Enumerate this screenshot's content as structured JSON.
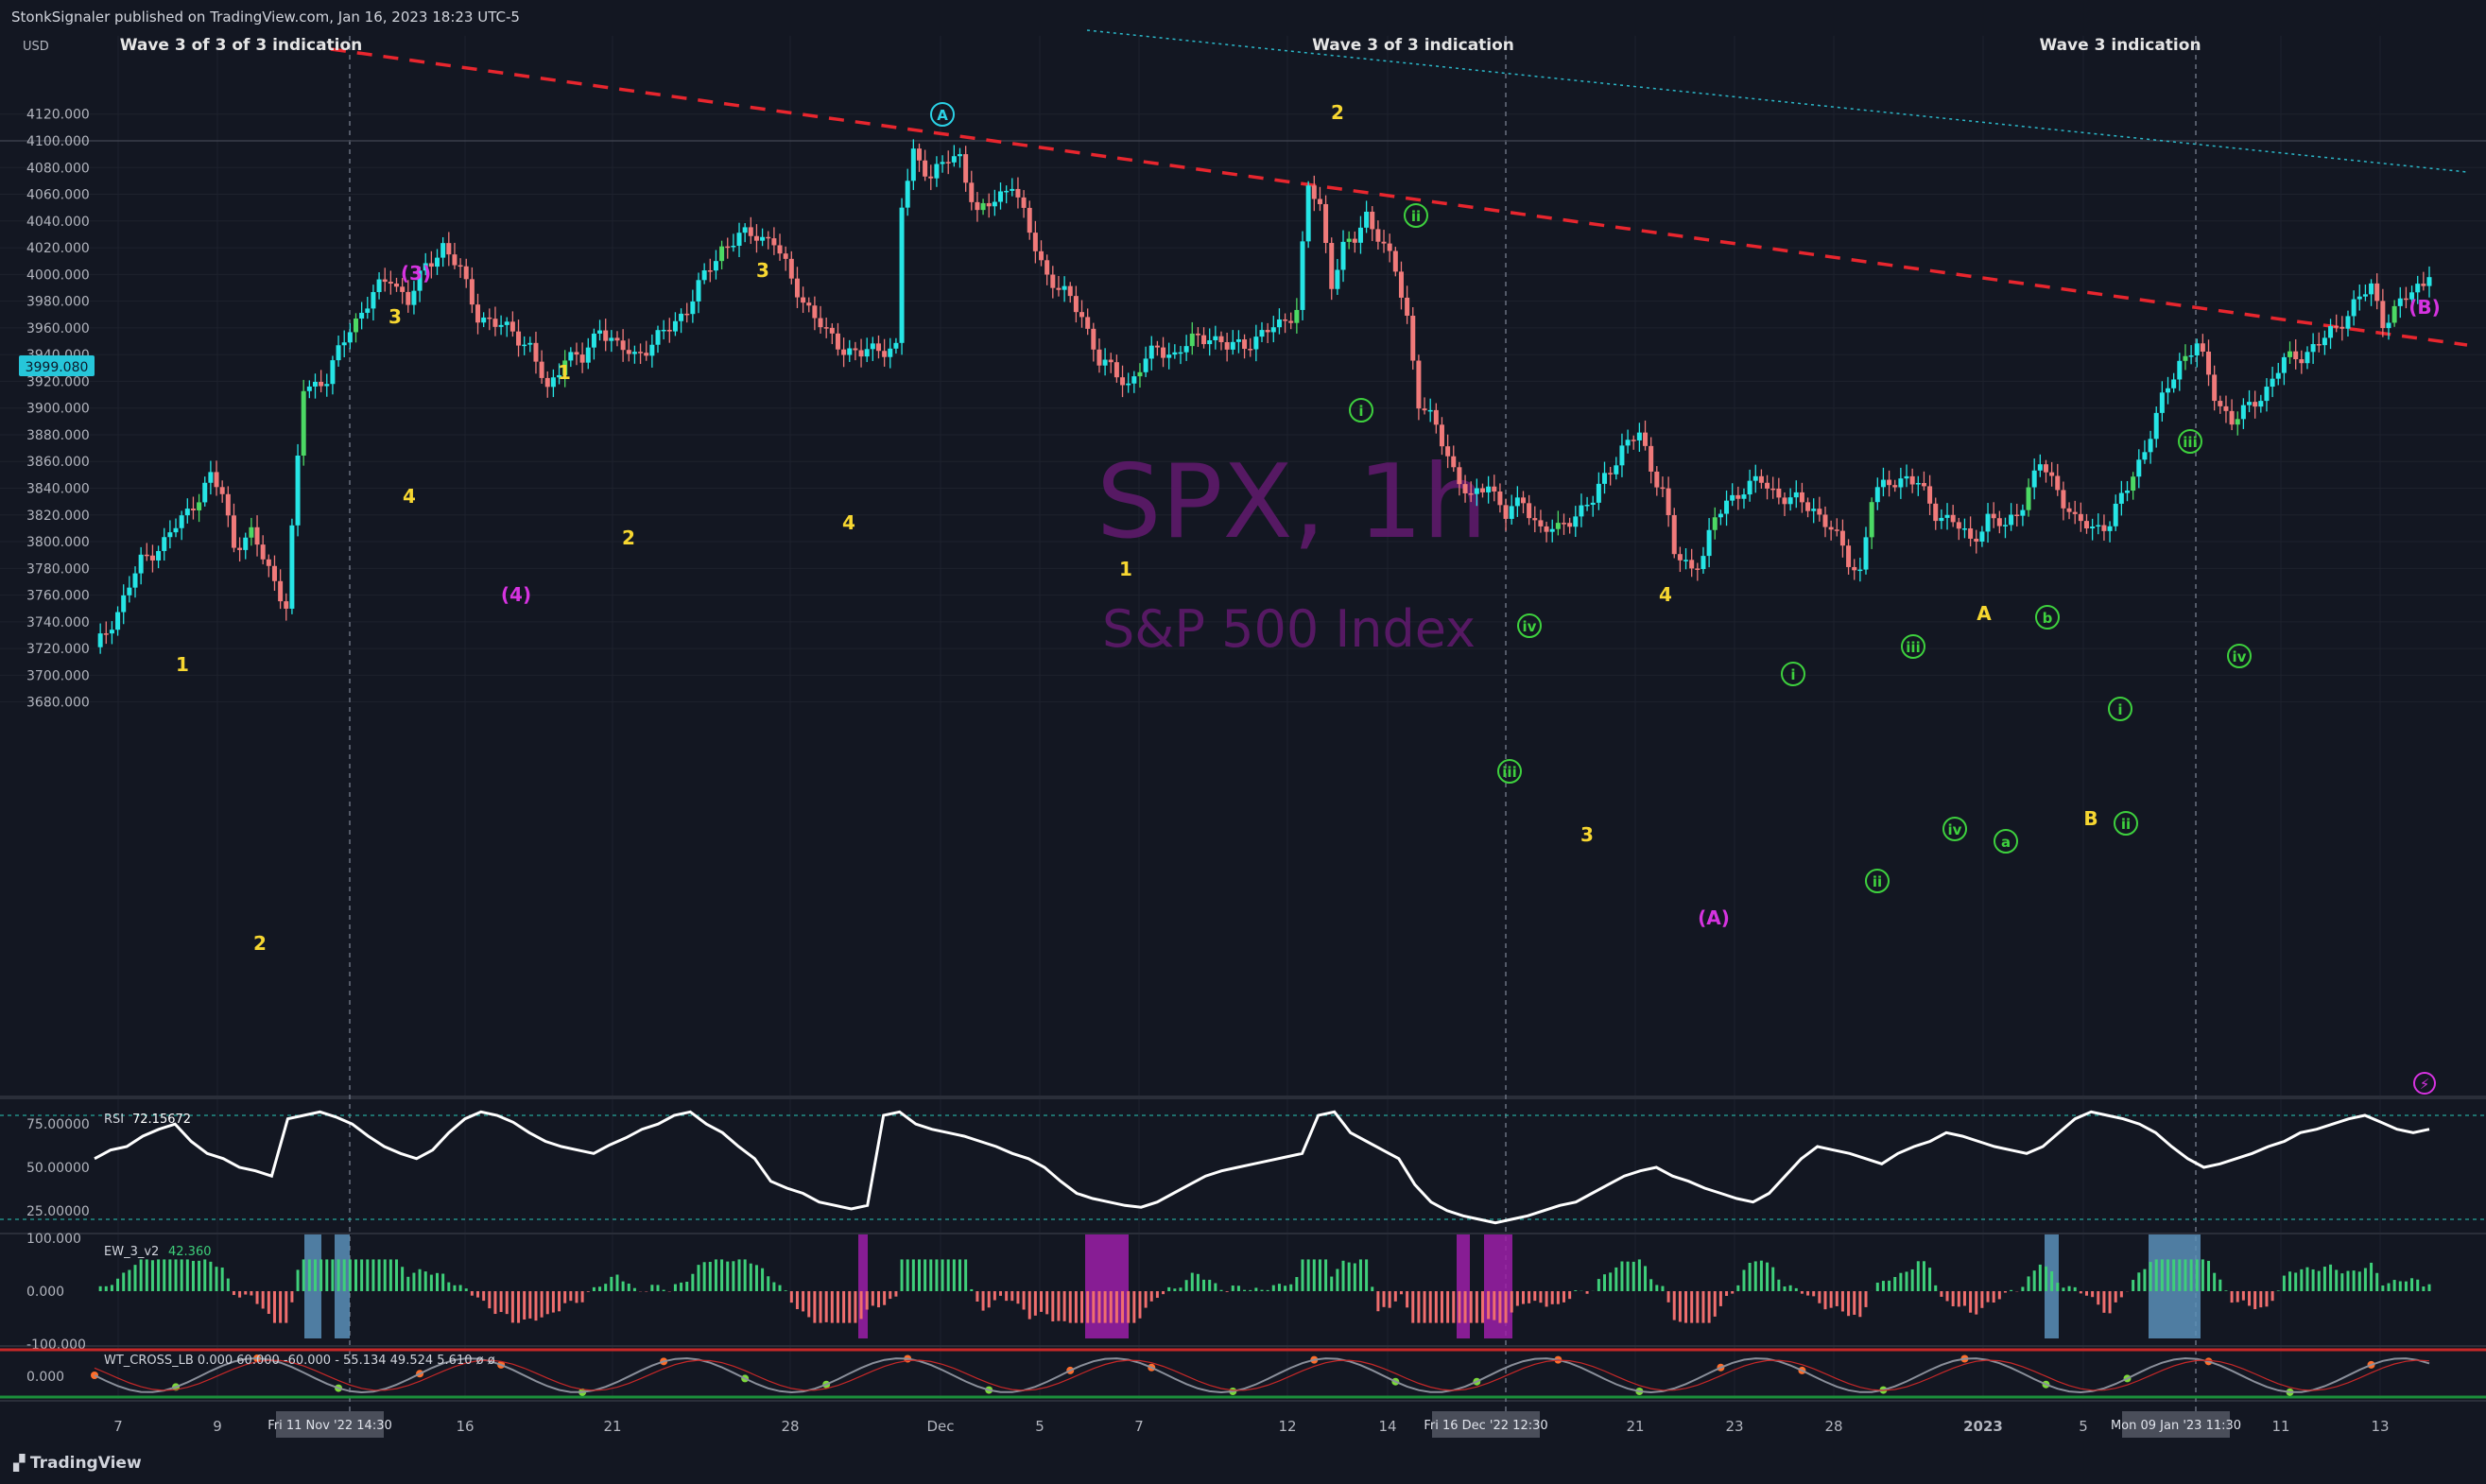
{
  "header": {
    "published": "StonkSignaler published on TradingView.com, Jan 16, 2023 18:23 UTC-5",
    "currency": "USD"
  },
  "watermark": {
    "symbol": "SPX, 1h",
    "name": "S&P 500 Index"
  },
  "footer": {
    "brand": "TradingView"
  },
  "colors": {
    "background": "#131722",
    "up": "#26e5e5",
    "down": "#f07a7a",
    "greenCandle": "#4cd964",
    "trendline": "#e8262e",
    "dotted": "#2bb7c8",
    "watermark": "#5e1a6b",
    "wave_yellow": "#f7d731",
    "wave_magenta": "#d633e0",
    "wave_green": "#3ed13e",
    "wave_cyan": "#2bd1e5"
  },
  "price_label": "3999.080",
  "annotations": [
    {
      "text": "Wave 3 of 3 of 3 indication"
    },
    {
      "text": "Wave 3 of 3 indication"
    },
    {
      "text": "Wave 3 indication"
    }
  ],
  "chart_data": [
    {
      "type": "candlestick",
      "title": "SPX, 1h",
      "subtitle": "S&P 500 Index",
      "ylabel": "USD",
      "ylim": [
        3665,
        4135
      ],
      "y_ticks": [
        3680,
        3700,
        3720,
        3740,
        3760,
        3780,
        3800,
        3820,
        3840,
        3860,
        3880,
        3900,
        3920,
        3940,
        3960,
        3980,
        4000,
        4020,
        4040,
        4060,
        4080,
        4100,
        4120
      ],
      "y_tick_labels": [
        "3680.000",
        "3700.000",
        "3720.000",
        "3740.000",
        "3760.000",
        "3780.000",
        "3800.000",
        "3820.000",
        "3840.000",
        "3860.000",
        "3880.000",
        "3900.000",
        "3920.000",
        "3940.000",
        "3960.000",
        "3980.000",
        "4000.000",
        "4020.000",
        "4040.000",
        "4060.000",
        "4080.000",
        "4100.000",
        "4120.000"
      ],
      "x_tick_labels": [
        "7",
        "9",
        "16",
        "21",
        "28",
        "Dec",
        "5",
        "7",
        "12",
        "14",
        "21",
        "23",
        "28",
        "2023",
        "5",
        "11",
        "13"
      ],
      "x_date_tags": [
        "Fri 11 Nov '22  14:30",
        "Fri 16 Dec '22  12:30",
        "Mon 09 Jan '23  11:30"
      ],
      "series": [
        {
          "name": "SPX",
          "close_path": [
            [
              0,
              3718
            ],
            [
              4,
              3748
            ],
            [
              8,
              3785
            ],
            [
              12,
              3800
            ],
            [
              16,
              3822
            ],
            [
              20,
              3848
            ],
            [
              22,
              3835
            ],
            [
              24,
              3798
            ],
            [
              27,
              3805
            ],
            [
              30,
              3780
            ],
            [
              33,
              3752
            ],
            [
              36,
              3915
            ],
            [
              40,
              3922
            ],
            [
              44,
              3960
            ],
            [
              48,
              3985
            ],
            [
              51,
              3998
            ],
            [
              54,
              3980
            ],
            [
              57,
              4005
            ],
            [
              60,
              4022
            ],
            [
              63,
              4002
            ],
            [
              66,
              3970
            ],
            [
              69,
              3962
            ],
            [
              72,
              3958
            ],
            [
              75,
              3945
            ],
            [
              78,
              3912
            ],
            [
              81,
              3940
            ],
            [
              84,
              3935
            ],
            [
              87,
              3962
            ],
            [
              90,
              3945
            ],
            [
              93,
              3940
            ],
            [
              96,
              3948
            ],
            [
              99,
              3960
            ],
            [
              102,
              3975
            ],
            [
              105,
              3998
            ],
            [
              108,
              4020
            ],
            [
              111,
              4028
            ],
            [
              114,
              4030
            ],
            [
              117,
              4025
            ],
            [
              120,
              3995
            ],
            [
              123,
              3975
            ],
            [
              126,
              3955
            ],
            [
              129,
              3945
            ],
            [
              132,
              3940
            ],
            [
              135,
              3945
            ],
            [
              138,
              3945
            ],
            [
              139,
              4050
            ],
            [
              141,
              4090
            ],
            [
              144,
              4075
            ],
            [
              147,
              4085
            ],
            [
              149,
              4088
            ],
            [
              152,
              4045
            ],
            [
              155,
              4055
            ],
            [
              158,
              4070
            ],
            [
              161,
              4030
            ],
            [
              164,
              4000
            ],
            [
              167,
              3985
            ],
            [
              170,
              3970
            ],
            [
              173,
              3935
            ],
            [
              176,
              3925
            ],
            [
              178,
              3918
            ],
            [
              180,
              3930
            ],
            [
              183,
              3945
            ],
            [
              186,
              3940
            ],
            [
              189,
              3950
            ],
            [
              192,
              3955
            ],
            [
              195,
              3945
            ],
            [
              198,
              3948
            ],
            [
              201,
              3955
            ],
            [
              204,
              3962
            ],
            [
              207,
              3975
            ],
            [
              209,
              4065
            ],
            [
              211,
              4050
            ],
            [
              213,
              3995
            ],
            [
              215,
              4020
            ],
            [
              217,
              4025
            ],
            [
              219,
              4045
            ],
            [
              221,
              4030
            ],
            [
              224,
              4002
            ],
            [
              226,
              3968
            ],
            [
              228,
              3905
            ],
            [
              231,
              3885
            ],
            [
              234,
              3855
            ],
            [
              237,
              3830
            ],
            [
              240,
              3845
            ],
            [
              243,
              3820
            ],
            [
              246,
              3830
            ],
            [
              249,
              3810
            ],
            [
              252,
              3808
            ],
            [
              255,
              3822
            ],
            [
              258,
              3830
            ],
            [
              260,
              3848
            ],
            [
              263,
              3870
            ],
            [
              266,
              3880
            ],
            [
              268,
              3855
            ],
            [
              270,
              3840
            ],
            [
              272,
              3790
            ],
            [
              275,
              3780
            ],
            [
              277,
              3792
            ],
            [
              279,
              3815
            ],
            [
              281,
              3830
            ],
            [
              284,
              3840
            ],
            [
              287,
              3845
            ],
            [
              290,
              3835
            ],
            [
              293,
              3830
            ],
            [
              296,
              3825
            ],
            [
              299,
              3810
            ],
            [
              302,
              3785
            ],
            [
              304,
              3778
            ],
            [
              306,
              3832
            ],
            [
              309,
              3845
            ],
            [
              312,
              3848
            ],
            [
              314,
              3842
            ],
            [
              317,
              3822
            ],
            [
              320,
              3815
            ],
            [
              323,
              3800
            ],
            [
              326,
              3818
            ],
            [
              329,
              3810
            ],
            [
              332,
              3830
            ],
            [
              335,
              3858
            ],
            [
              338,
              3840
            ],
            [
              341,
              3815
            ],
            [
              344,
              3810
            ],
            [
              347,
              3815
            ],
            [
              350,
              3840
            ],
            [
              353,
              3870
            ],
            [
              356,
              3905
            ],
            [
              359,
              3935
            ],
            [
              362,
              3948
            ],
            [
              365,
              3910
            ],
            [
              368,
              3890
            ],
            [
              371,
              3900
            ],
            [
              374,
              3915
            ],
            [
              377,
              3935
            ],
            [
              380,
              3940
            ],
            [
              383,
              3948
            ],
            [
              386,
              3960
            ],
            [
              389,
              3978
            ],
            [
              392,
              3990
            ],
            [
              394,
              3965
            ],
            [
              397,
              3978
            ],
            [
              400,
              3990
            ],
            [
              402,
              3998
            ]
          ]
        }
      ]
    },
    {
      "type": "line",
      "title": "RSI",
      "series": [
        {
          "name": "RSI",
          "last": "72.15672"
        }
      ],
      "ylim": [
        15,
        90
      ],
      "y_ticks": [
        25,
        50,
        75
      ],
      "y_tick_labels": [
        "25.00000",
        "50.00000",
        "75.00000"
      ],
      "levels": [
        20,
        80
      ],
      "wave": [
        55,
        60,
        62,
        68,
        72,
        75,
        65,
        58,
        55,
        50,
        48,
        45,
        78,
        80,
        82,
        79,
        75,
        68,
        62,
        58,
        55,
        60,
        70,
        78,
        82,
        80,
        76,
        70,
        65,
        62,
        60,
        58,
        63,
        67,
        72,
        75,
        80,
        82,
        75,
        70,
        62,
        55,
        42,
        38,
        35,
        30,
        28,
        26,
        28,
        80,
        82,
        75,
        72,
        70,
        68,
        65,
        62,
        58,
        55,
        50,
        42,
        35,
        32,
        30,
        28,
        27,
        30,
        35,
        40,
        45,
        48,
        50,
        52,
        54,
        56,
        58,
        80,
        82,
        70,
        65,
        60,
        55,
        40,
        30,
        25,
        22,
        20,
        18,
        20,
        22,
        25,
        28,
        30,
        35,
        40,
        45,
        48,
        50,
        45,
        42,
        38,
        35,
        32,
        30,
        35,
        45,
        55,
        62,
        60,
        58,
        55,
        52,
        58,
        62,
        65,
        70,
        68,
        65,
        62,
        60,
        58,
        62,
        70,
        78,
        82,
        80,
        78,
        75,
        70,
        62,
        55,
        50,
        52,
        55,
        58,
        62,
        65,
        70,
        72,
        75,
        78,
        80,
        76,
        72,
        70,
        72
      ]
    },
    {
      "type": "bar",
      "title": "EW_3_v2",
      "series": [
        {
          "name": "EW_3_v2",
          "last": "42.360"
        }
      ],
      "ylim": [
        -100,
        100
      ],
      "y_ticks": [
        -100,
        0,
        100
      ],
      "y_tick_labels": [
        "-100.000",
        "0.000",
        "100.000"
      ]
    },
    {
      "type": "line",
      "title": "WT_CROSS_LB",
      "y_ticks": [
        0
      ],
      "y_tick_labels": [
        "0.000"
      ],
      "header_values": [
        "0.000",
        "60.000",
        "-60.000",
        "-",
        "55.134",
        "49.524",
        "5.610",
        "ø",
        "ø"
      ]
    }
  ],
  "wave_labels": [
    {
      "text": "1",
      "color": "yellow"
    },
    {
      "text": "2",
      "color": "yellow"
    },
    {
      "text": "3",
      "color": "yellow"
    },
    {
      "text": "4",
      "color": "yellow"
    },
    {
      "text": "(3)",
      "color": "magenta"
    },
    {
      "text": "(4)",
      "color": "magenta"
    },
    {
      "text": "1",
      "color": "yellow"
    },
    {
      "text": "2",
      "color": "yellow"
    },
    {
      "text": "3",
      "color": "yellow"
    },
    {
      "text": "4",
      "color": "yellow"
    },
    {
      "text": "A",
      "color": "cyan"
    },
    {
      "text": "2",
      "color": "yellow"
    },
    {
      "text": "1",
      "color": "yellow"
    },
    {
      "text": "ii",
      "color": "green"
    },
    {
      "text": "i",
      "color": "green"
    },
    {
      "text": "iv",
      "color": "green"
    },
    {
      "text": "iii",
      "color": "green"
    },
    {
      "text": "3",
      "color": "yellow"
    },
    {
      "text": "4",
      "color": "yellow"
    },
    {
      "text": "(A)",
      "color": "magenta"
    },
    {
      "text": "i",
      "color": "green"
    },
    {
      "text": "ii",
      "color": "green"
    },
    {
      "text": "iii",
      "color": "green"
    },
    {
      "text": "iv",
      "color": "green"
    },
    {
      "text": "A",
      "color": "yellow"
    },
    {
      "text": "a",
      "color": "green"
    },
    {
      "text": "b",
      "color": "green"
    },
    {
      "text": "B",
      "color": "yellow"
    },
    {
      "text": "i",
      "color": "green"
    },
    {
      "text": "ii",
      "color": "green"
    },
    {
      "text": "iii",
      "color": "green"
    },
    {
      "text": "iv",
      "color": "green"
    },
    {
      "text": "(B)",
      "color": "magenta"
    }
  ]
}
